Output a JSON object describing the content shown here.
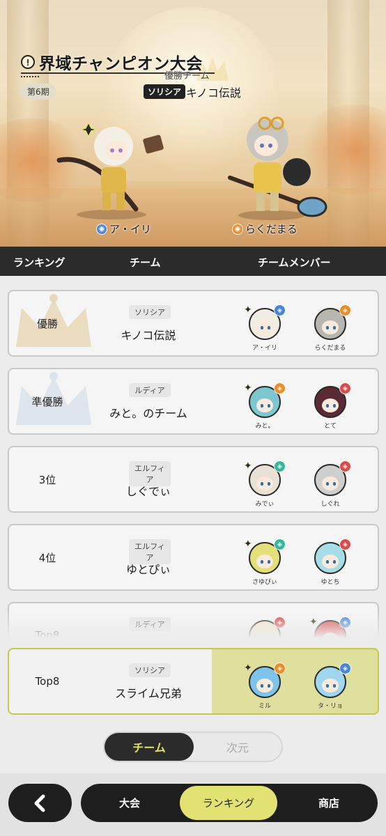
{
  "event": {
    "title": "界域チャンピオン大会",
    "season": "第6期",
    "champion_label": "優勝チーム",
    "champion_server": "ソリシア",
    "champion_team": "キノコ伝説"
  },
  "champions": [
    {
      "name": "ア・イリ",
      "element_color": "#4a84d8"
    },
    {
      "name": "らくだまる",
      "element_color": "#e98d2f"
    }
  ],
  "columns": {
    "ranking": "ランキング",
    "team": "チーム",
    "members": "チームメンバー"
  },
  "rows": [
    {
      "rank": "優勝",
      "crown": "gold",
      "server": "ソリシア",
      "team": "キノコ伝説",
      "members": [
        {
          "name": "ア・イリ",
          "element_color": "#4a84d8",
          "hair": "#f2ede2",
          "leader": true
        },
        {
          "name": "らくだまる",
          "element_color": "#e98d2f",
          "hair": "#b8b6b0",
          "leader": false
        }
      ]
    },
    {
      "rank": "準優勝",
      "crown": "silver",
      "server": "ルディア",
      "team": "みと。のチーム",
      "members": [
        {
          "name": "みと。",
          "element_color": "#e98d2f",
          "hair": "#7fc7d0",
          "leader": true
        },
        {
          "name": "とて",
          "element_color": "#d94a4a",
          "hair": "#5a2a35",
          "leader": false
        }
      ]
    },
    {
      "rank": "3位",
      "crown": "",
      "server": "エルフィア",
      "team": "しぐでぃ",
      "members": [
        {
          "name": "みでぃ",
          "element_color": "#3ab59a",
          "hair": "#e8e2d6",
          "leader": true
        },
        {
          "name": "しぐれ",
          "element_color": "#d94a4a",
          "hair": "#cfcfcf",
          "leader": false
        }
      ]
    },
    {
      "rank": "4位",
      "crown": "",
      "server": "エルフィア",
      "team": "ゆとぴぃ",
      "members": [
        {
          "name": "さゆぴぃ",
          "element_color": "#3ab59a",
          "hair": "#e3e07a",
          "leader": true
        },
        {
          "name": "ゆとち",
          "element_color": "#d94a4a",
          "hair": "#a6dde6",
          "leader": false
        }
      ]
    },
    {
      "rank": "Top8",
      "crown": "",
      "server": "ルディア",
      "team": "",
      "members": [
        {
          "name": "",
          "element_color": "#d94a4a",
          "hair": "#f1e7c8",
          "leader": false
        },
        {
          "name": "",
          "element_color": "#4a84d8",
          "hair": "#e04848",
          "leader": true
        }
      ]
    }
  ],
  "my_team": {
    "rank": "Top8",
    "server": "ソリシア",
    "team": "スライム兄弟",
    "members": [
      {
        "name": "ミル",
        "element_color": "#e98d2f",
        "hair": "#7ec4ea",
        "leader": true
      },
      {
        "name": "タ・リョ",
        "element_color": "#4a84d8",
        "hair": "#9fd7ee",
        "leader": false
      }
    ]
  },
  "toggle": {
    "active": "チーム",
    "inactive": "次元"
  },
  "nav": {
    "back_icon": "chevron-left-icon",
    "tabs": [
      "大会",
      "ランキング",
      "商店"
    ],
    "active_tab": "ランキング"
  },
  "colors": {
    "accent": "#e1e272",
    "dark": "#1e1e1e"
  }
}
